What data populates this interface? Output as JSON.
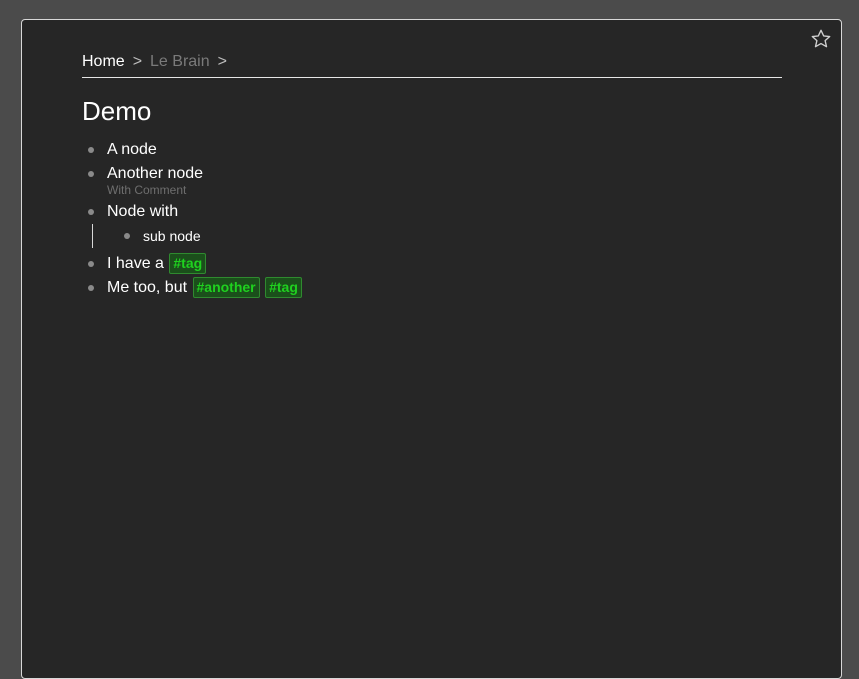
{
  "breadcrumb": {
    "home": "Home",
    "separator": ">",
    "current": "Le Brain"
  },
  "page": {
    "title": "Demo"
  },
  "nodes": [
    {
      "text": "A node"
    },
    {
      "text": "Another node",
      "comment": "With Comment"
    },
    {
      "text": "Node with",
      "children": [
        {
          "text": "sub node"
        }
      ]
    },
    {
      "text": "I have a",
      "tags": [
        "#tag"
      ]
    },
    {
      "text": "Me too, but",
      "tags": [
        "#another",
        "#tag"
      ]
    }
  ],
  "icons": {
    "favorite": "star-outline-icon"
  },
  "colors": {
    "background": "#262626",
    "tag_text": "#1fd11f",
    "tag_bg": "#1b4f1b"
  }
}
